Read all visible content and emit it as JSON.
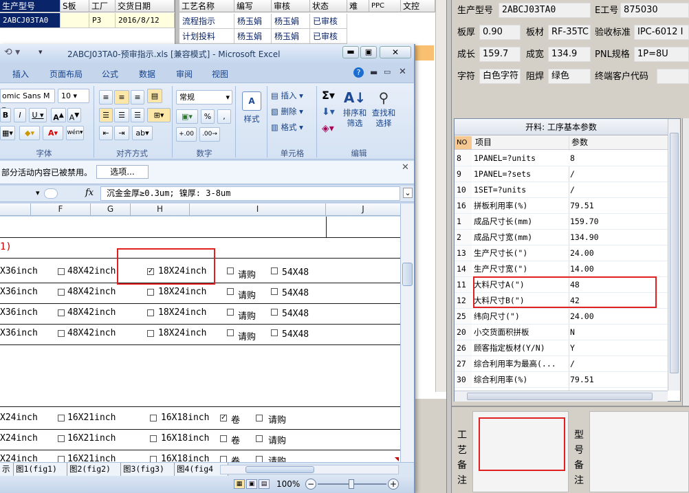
{
  "top_grid": {
    "headers": [
      "生产型号",
      "S板",
      "工厂",
      "交货日期"
    ],
    "row": [
      "2ABCJ03TA0",
      "",
      "P3",
      "2016/8/12"
    ]
  },
  "mid_grid": {
    "headers": [
      "工艺名称",
      "编写",
      "审核",
      "状态",
      "难",
      "PPC",
      "文控"
    ],
    "rows": [
      [
        "流程指示",
        "杨玉娟",
        "杨玉娟",
        "已审核"
      ],
      [
        "计划投料",
        "杨玉娟",
        "杨玉娟",
        "已审核"
      ]
    ]
  },
  "info": {
    "model_label": "生产型号",
    "model_value": "2ABCJ03TA0",
    "e_label": "E工号",
    "e_value": "875030",
    "thick_label": "板厚",
    "thick_value": "0.90",
    "material_label": "板材",
    "material_value": "RF-35TC",
    "std_label": "验收标准",
    "std_value": "IPC-6012 I",
    "len_label": "成长",
    "len_value": "159.7",
    "wid_label": "成宽",
    "wid_value": "134.9",
    "pnl_label": "PNL规格",
    "pnl_value": "1P=8U",
    "char_label": "字符",
    "char_value": "白色字符",
    "mask_label": "阻焊",
    "mask_value": "绿色",
    "cust_label": "终端客户代码",
    "cust_value": ""
  },
  "params": {
    "title": "开料: 工序基本参数",
    "col_no": "NO",
    "col_item": "项目",
    "col_param": "参数",
    "rows": [
      {
        "no": "8",
        "item": "1PANEL=?units",
        "param": "8"
      },
      {
        "no": "9",
        "item": "1PANEL=?sets",
        "param": "/"
      },
      {
        "no": "10",
        "item": "1SET=?units",
        "param": "/"
      },
      {
        "no": "16",
        "item": "拼板利用率(%)",
        "param": "79.51"
      },
      {
        "no": "1",
        "item": "成品尺寸长(mm)",
        "param": "159.70"
      },
      {
        "no": "2",
        "item": "成品尺寸宽(mm)",
        "param": "134.90"
      },
      {
        "no": "13",
        "item": "生产尺寸长(\")",
        "param": "24.00"
      },
      {
        "no": "14",
        "item": "生产尺寸宽(\")",
        "param": "14.00"
      },
      {
        "no": "11",
        "item": "大料尺寸A(\")",
        "param": "48"
      },
      {
        "no": "12",
        "item": "大料尺寸B(\")",
        "param": "42"
      },
      {
        "no": "25",
        "item": "纬向尺寸(\")",
        "param": "24.00"
      },
      {
        "no": "20",
        "item": "小交货面积拼板",
        "param": "N"
      },
      {
        "no": "26",
        "item": "顾客指定板材(Y/N)",
        "param": "Y"
      },
      {
        "no": "27",
        "item": "综合利用率为最高(...",
        "param": "/"
      },
      {
        "no": "30",
        "item": "综合利用率(%)",
        "param": "79.51"
      }
    ]
  },
  "notes": {
    "process_label": "工艺备注",
    "model_label": "型号备注"
  },
  "excel": {
    "title": "2ABCJ03TA0-预审指示.xls  [兼容模式] - Microsoft Excel",
    "tabs": [
      "插入",
      "页面布局",
      "公式",
      "数据",
      "审阅",
      "视图"
    ],
    "font_name": "omic Sans M",
    "font_size": "10",
    "number_format": "常规",
    "insert": "插入",
    "delete": "删除",
    "format": "格式",
    "styles": "样式",
    "sort": "排序和\n筛选",
    "find": "查找和\n选择",
    "groups": [
      "字体",
      "对齐方式",
      "数字",
      "单元格",
      "编辑"
    ],
    "security_msg": "部分活动内容已被禁用。",
    "options_btn": "选项...",
    "formula": "沉金金厚≥0.3um; 镍厚: 3-8um",
    "columns": [
      "F",
      "G",
      "H",
      "I",
      "J"
    ],
    "sheet_tabs": [
      "示",
      "图1(fig1)",
      "图2(fig2)",
      "图3(fig3)",
      "图4(fig4"
    ],
    "zoom": "100%",
    "marker": "1)",
    "rows_a": [
      {
        "a": "X36inch",
        "b": "48X42inch",
        "c": "18X24inch",
        "d": "请购",
        "e": "54X48",
        "c_checked": true
      },
      {
        "a": "X36inch",
        "b": "48X42inch",
        "c": "18X24inch",
        "d": "请购",
        "e": "54X48",
        "c_checked": false
      },
      {
        "a": "X36inch",
        "b": "48X42inch",
        "c": "18X24inch",
        "d": "请购",
        "e": "54X48",
        "c_checked": false
      },
      {
        "a": "X36inch",
        "b": "48X42inch",
        "c": "18X24inch",
        "d": "请购",
        "e": "54X48",
        "c_checked": false
      }
    ],
    "rows_b": [
      {
        "a": "X24inch",
        "b": "16X21inch",
        "c": "16X18inch",
        "d": "卷",
        "e": "请购",
        "d_checked": true
      },
      {
        "a": "X24inch",
        "b": "16X21inch",
        "c": "16X18inch",
        "d": "卷",
        "e": "请购",
        "d_checked": false
      },
      {
        "a": "X24inch",
        "b": "16X21inch",
        "c": "16X18inch",
        "d": "卷",
        "e": "请购",
        "d_checked": false
      }
    ]
  }
}
